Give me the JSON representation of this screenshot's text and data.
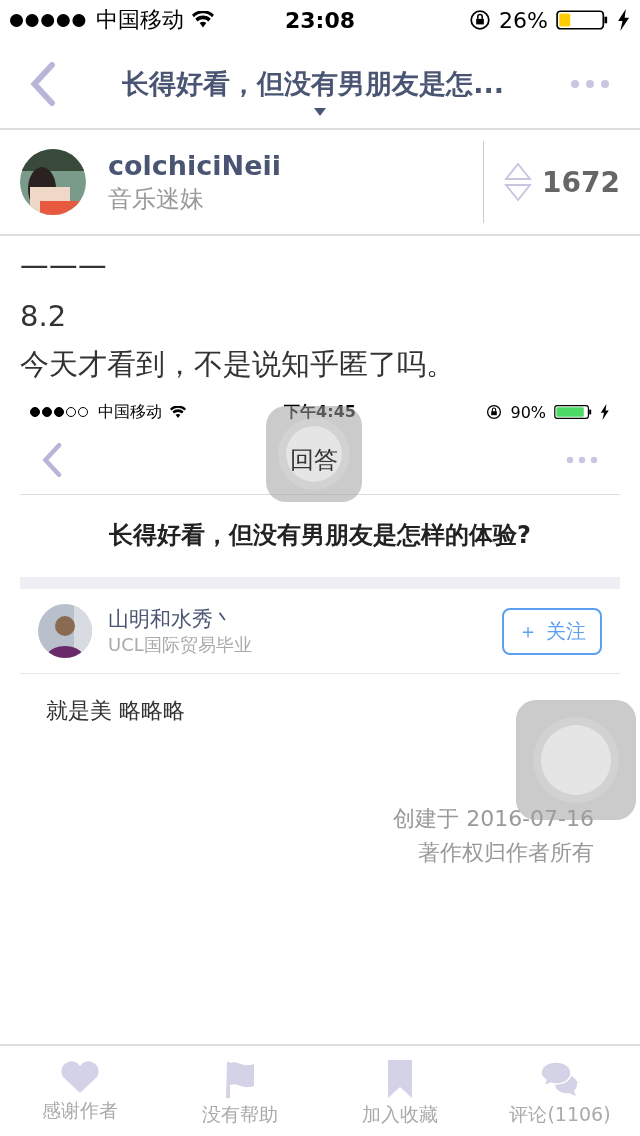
{
  "status_bar": {
    "carrier": "中国移动",
    "time": "23:08",
    "battery": "26%"
  },
  "nav": {
    "title": "长得好看，但没有男朋友是怎..."
  },
  "author": {
    "name": "colchiciNeii",
    "bio": "音乐迷妹",
    "votes": "1672"
  },
  "content": [
    "一一一",
    "8.2",
    "今天才看到，不是说知乎匿了吗。"
  ],
  "screenshot": {
    "status_bar": {
      "carrier": "中国移动",
      "time": "下午4:45",
      "battery": "90%"
    },
    "nav_title": "回答",
    "question": "长得好看，但没有男朋友是怎样的体验?",
    "author": {
      "name": "山明和水秀丶",
      "bio": "UCL国际贸易毕业",
      "follow": "关注",
      "follow_icon": "＋"
    },
    "answer": "就是美 略略略",
    "created": "创建于 2016-07-16",
    "copyright": "著作权归作者所有"
  },
  "toolbar": [
    {
      "kind": "heart",
      "label": "感谢作者"
    },
    {
      "kind": "flag",
      "label": "没有帮助"
    },
    {
      "kind": "bookmark",
      "label": "加入收藏"
    },
    {
      "kind": "comment",
      "label": "评论(1106)"
    }
  ]
}
